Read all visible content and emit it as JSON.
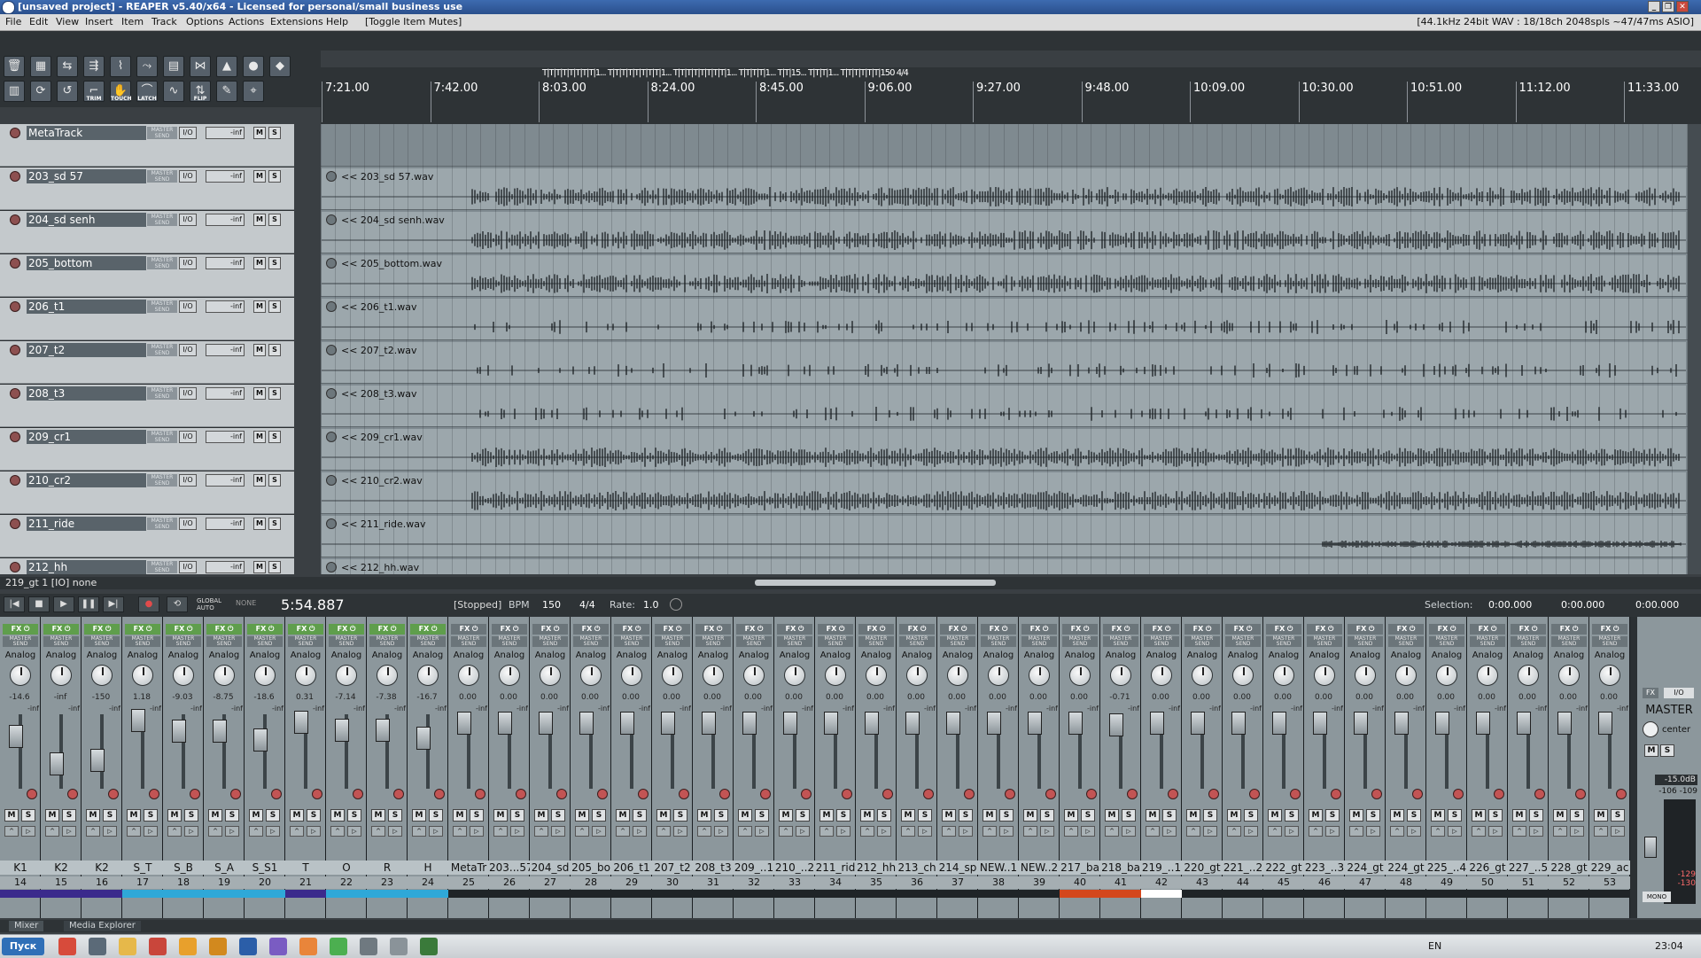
{
  "window": {
    "title": "[unsaved project] - REAPER v5.40/x64 - Licensed for personal/small business use",
    "controls": [
      "_",
      "❐",
      "✕"
    ]
  },
  "menu": {
    "items": [
      "File",
      "Edit",
      "View",
      "Insert",
      "Item",
      "Track",
      "Options",
      "Actions",
      "Extensions",
      "Help",
      "[Toggle Item Mutes]"
    ],
    "status": "[44.1kHz 24bit WAV : 18/18ch 2048spls ~47/47ms ASIO]"
  },
  "toolbar": {
    "row1": [
      {
        "icon": "trash-icon",
        "glyph": "🗑"
      },
      {
        "icon": "grid-icon",
        "glyph": "▦"
      },
      {
        "icon": "split-icon",
        "glyph": "⇆"
      },
      {
        "icon": "ripple-icon",
        "glyph": "⇶"
      },
      {
        "icon": "snap-icon",
        "glyph": "⌇"
      },
      {
        "icon": "envelope-icon",
        "glyph": "⤳"
      },
      {
        "icon": "group-icon",
        "glyph": "▤"
      },
      {
        "icon": "crossfade-icon",
        "glyph": "⋈"
      },
      {
        "icon": "metronome-icon",
        "glyph": "▲"
      },
      {
        "icon": "record-mode-icon",
        "glyph": "●"
      },
      {
        "icon": "render-icon",
        "glyph": "◆"
      }
    ],
    "row2": [
      {
        "icon": "mixer-icon",
        "glyph": "▥",
        "label": ""
      },
      {
        "icon": "loop-icon",
        "glyph": "⟳",
        "label": ""
      },
      {
        "icon": "undo-icon",
        "glyph": "↺",
        "label": ""
      },
      {
        "icon": "trim-icon",
        "glyph": "⌐",
        "label": "TRIM"
      },
      {
        "icon": "touch-icon",
        "glyph": "✋",
        "label": "TOUCH"
      },
      {
        "icon": "latch-icon",
        "glyph": "⌒",
        "label": "LATCH"
      },
      {
        "icon": "automation-icon",
        "glyph": "∿",
        "label": ""
      },
      {
        "icon": "flip-icon",
        "glyph": "⇅",
        "label": "FLIP"
      },
      {
        "icon": "pencil-icon",
        "glyph": "✎",
        "label": ""
      },
      {
        "icon": "cursor-icon",
        "glyph": "⌖",
        "label": ""
      }
    ]
  },
  "markers": {
    "text": "T|T|T|T|T|T|T|T|1... T|T|T|T|T|T|T|T|1... T|T|T|T|T|T|T|T|1... T|T|T|T|1... T|T|15... T|T|T|1... T|T|T|T|T|T|150 4/4"
  },
  "ruler": {
    "ticks": [
      "7:21.00",
      "7:42.00",
      "8:03.00",
      "8:24.00",
      "8:45.00",
      "9:06.00",
      "9:27.00",
      "9:48.00",
      "10:09.00",
      "10:30.00",
      "10:51.00",
      "11:12.00",
      "11:33.00"
    ]
  },
  "tracks": [
    {
      "name": "MetaTrack",
      "number": "25",
      "item": "",
      "vol": "-inf",
      "io": "I/O",
      "master_send": "MASTER SEND",
      "m": "M",
      "s": "S"
    },
    {
      "name": "203_sd 57",
      "number": "26",
      "item": "<< 203_sd 57.wav",
      "vol": "-inf",
      "io": "I/O",
      "master_send": "MASTER SEND",
      "m": "M",
      "s": "S"
    },
    {
      "name": "204_sd senh",
      "number": "27",
      "item": "<< 204_sd senh.wav",
      "vol": "-inf",
      "io": "I/O",
      "master_send": "MASTER SEND",
      "m": "M",
      "s": "S"
    },
    {
      "name": "205_bottom",
      "number": "28",
      "item": "<< 205_bottom.wav",
      "vol": "-inf",
      "io": "I/O",
      "master_send": "MASTER SEND",
      "m": "M",
      "s": "S"
    },
    {
      "name": "206_t1",
      "number": "29",
      "item": "<< 206_t1.wav",
      "vol": "-inf",
      "io": "I/O",
      "master_send": "MASTER SEND",
      "m": "M",
      "s": "S"
    },
    {
      "name": "207_t2",
      "number": "30",
      "item": "<< 207_t2.wav",
      "vol": "-inf",
      "io": "I/O",
      "master_send": "MASTER SEND",
      "m": "M",
      "s": "S"
    },
    {
      "name": "208_t3",
      "number": "31",
      "item": "<< 208_t3.wav",
      "vol": "-inf",
      "io": "I/O",
      "master_send": "MASTER SEND",
      "m": "M",
      "s": "S"
    },
    {
      "name": "209_cr1",
      "number": "32",
      "item": "<< 209_cr1.wav",
      "vol": "-inf",
      "io": "I/O",
      "master_send": "MASTER SEND",
      "m": "M",
      "s": "S"
    },
    {
      "name": "210_cr2",
      "number": "33",
      "item": "<< 210_cr2.wav",
      "vol": "-inf",
      "io": "I/O",
      "master_send": "MASTER SEND",
      "m": "M",
      "s": "S"
    },
    {
      "name": "211_ride",
      "number": "34",
      "item": "<< 211_ride.wav",
      "vol": "-inf",
      "io": "I/O",
      "master_send": "MASTER SEND",
      "m": "M",
      "s": "S"
    },
    {
      "name": "212_hh",
      "number": "35",
      "item": "<< 212_hh.wav",
      "vol": "-inf",
      "io": "I/O",
      "master_send": "MASTER SEND",
      "m": "M",
      "s": "S"
    }
  ],
  "status_line": "219_gt 1 [IO] none",
  "transport": {
    "buttons": [
      "|◀",
      "■",
      "▶",
      "❚❚",
      "▶|",
      "●",
      "⟲"
    ],
    "auto": "GLOBAL AUTO",
    "auto_state": "NONE",
    "time": "5:54.887",
    "state": "[Stopped]",
    "bpm_label": "BPM",
    "bpm": "150",
    "sig": "4/4",
    "rate_label": "Rate:",
    "rate": "1.0",
    "selection_label": "Selection:",
    "sel_start": "0:00.000",
    "sel_end": "0:00.000",
    "sel_len": "0:00.000"
  },
  "mixer": {
    "fx_label": "FX ⏻",
    "input_label": "Analog",
    "master_send": "MASTER SEND",
    "m": "M",
    "s": "S",
    "channels": [
      {
        "name": "K1",
        "num": "14",
        "db": "-14.6",
        "peak": "-inf",
        "fader": 0.62,
        "fx": true,
        "color": "#3b2a8c"
      },
      {
        "name": "K2",
        "num": "15",
        "db": "-inf",
        "peak": "-inf",
        "fader": 0.2,
        "fx": true,
        "color": "#3b2a8c"
      },
      {
        "name": "K2",
        "num": "16",
        "db": "-150",
        "peak": "-inf",
        "fader": 0.25,
        "fx": true,
        "color": "#3b2a8c"
      },
      {
        "name": "S_T",
        "num": "17",
        "db": "1.18",
        "peak": "-inf",
        "fader": 0.86,
        "fx": true,
        "color": "#2fa8d8"
      },
      {
        "name": "S_B",
        "num": "18",
        "db": "-9.03",
        "peak": "-inf",
        "fader": 0.7,
        "fx": true,
        "color": "#2fa8d8"
      },
      {
        "name": "S_A",
        "num": "19",
        "db": "-8.75",
        "peak": "-inf",
        "fader": 0.7,
        "fx": true,
        "color": "#2fa8d8"
      },
      {
        "name": "S_S1",
        "num": "20",
        "db": "-18.6",
        "peak": "-inf",
        "fader": 0.57,
        "fx": true,
        "color": "#2fa8d8"
      },
      {
        "name": "T",
        "num": "21",
        "db": "0.31",
        "peak": "-inf",
        "fader": 0.84,
        "fx": true,
        "color": "#3b2a8c"
      },
      {
        "name": "O",
        "num": "22",
        "db": "-7.14",
        "peak": "-inf",
        "fader": 0.72,
        "fx": true,
        "color": "#2fa8d8"
      },
      {
        "name": "R",
        "num": "23",
        "db": "-7.38",
        "peak": "-inf",
        "fader": 0.72,
        "fx": true,
        "color": "#2fa8d8"
      },
      {
        "name": "H",
        "num": "24",
        "db": "-16.7",
        "peak": "-inf",
        "fader": 0.6,
        "fx": true,
        "color": "#2fa8d8"
      },
      {
        "name": "MetaTr",
        "num": "25",
        "db": "0.00",
        "peak": "-inf",
        "fader": 0.82,
        "fx": false,
        "color": ""
      },
      {
        "name": "203...57",
        "num": "26",
        "db": "0.00",
        "peak": "-inf",
        "fader": 0.82,
        "fx": false,
        "color": ""
      },
      {
        "name": "204_sd",
        "num": "27",
        "db": "0.00",
        "peak": "-inf",
        "fader": 0.82,
        "fx": false,
        "color": ""
      },
      {
        "name": "205_bo",
        "num": "28",
        "db": "0.00",
        "peak": "-inf",
        "fader": 0.82,
        "fx": false,
        "color": ""
      },
      {
        "name": "206_t1",
        "num": "29",
        "db": "0.00",
        "peak": "-inf",
        "fader": 0.82,
        "fx": false,
        "color": ""
      },
      {
        "name": "207_t2",
        "num": "30",
        "db": "0.00",
        "peak": "-inf",
        "fader": 0.82,
        "fx": false,
        "color": ""
      },
      {
        "name": "208_t3",
        "num": "31",
        "db": "0.00",
        "peak": "-inf",
        "fader": 0.82,
        "fx": false,
        "color": ""
      },
      {
        "name": "209_..1",
        "num": "32",
        "db": "0.00",
        "peak": "-inf",
        "fader": 0.82,
        "fx": false,
        "color": ""
      },
      {
        "name": "210_..2",
        "num": "33",
        "db": "0.00",
        "peak": "-inf",
        "fader": 0.82,
        "fx": false,
        "color": ""
      },
      {
        "name": "211_rid",
        "num": "34",
        "db": "0.00",
        "peak": "-inf",
        "fader": 0.82,
        "fx": false,
        "color": ""
      },
      {
        "name": "212_hh",
        "num": "35",
        "db": "0.00",
        "peak": "-inf",
        "fader": 0.82,
        "fx": false,
        "color": ""
      },
      {
        "name": "213_ch",
        "num": "36",
        "db": "0.00",
        "peak": "-inf",
        "fader": 0.82,
        "fx": false,
        "color": ""
      },
      {
        "name": "214_sp",
        "num": "37",
        "db": "0.00",
        "peak": "-inf",
        "fader": 0.82,
        "fx": false,
        "color": ""
      },
      {
        "name": "NEW..1",
        "num": "38",
        "db": "0.00",
        "peak": "-inf",
        "fader": 0.82,
        "fx": false,
        "color": ""
      },
      {
        "name": "NEW..2",
        "num": "39",
        "db": "0.00",
        "peak": "-inf",
        "fader": 0.82,
        "fx": false,
        "color": ""
      },
      {
        "name": "217_ba",
        "num": "40",
        "db": "0.00",
        "peak": "-inf",
        "fader": 0.82,
        "fx": false,
        "color": "#d4471c"
      },
      {
        "name": "218_ba",
        "num": "41",
        "db": "-0.71",
        "peak": "-inf",
        "fader": 0.8,
        "fx": false,
        "color": "#d4471c"
      },
      {
        "name": "219_..1",
        "num": "42",
        "db": "0.00",
        "peak": "-inf",
        "fader": 0.82,
        "fx": false,
        "color": "#ffffff"
      },
      {
        "name": "220_gt",
        "num": "43",
        "db": "0.00",
        "peak": "-inf",
        "fader": 0.82,
        "fx": false,
        "color": ""
      },
      {
        "name": "221_..2",
        "num": "44",
        "db": "0.00",
        "peak": "-inf",
        "fader": 0.82,
        "fx": false,
        "color": ""
      },
      {
        "name": "222_gt",
        "num": "45",
        "db": "0.00",
        "peak": "-inf",
        "fader": 0.82,
        "fx": false,
        "color": ""
      },
      {
        "name": "223_..3",
        "num": "46",
        "db": "0.00",
        "peak": "-inf",
        "fader": 0.82,
        "fx": false,
        "color": ""
      },
      {
        "name": "224_gt",
        "num": "47",
        "db": "0.00",
        "peak": "-inf",
        "fader": 0.82,
        "fx": false,
        "color": ""
      },
      {
        "name": "224_gt",
        "num": "48",
        "db": "0.00",
        "peak": "-inf",
        "fader": 0.82,
        "fx": false,
        "color": ""
      },
      {
        "name": "225_..4",
        "num": "49",
        "db": "0.00",
        "peak": "-inf",
        "fader": 0.82,
        "fx": false,
        "color": ""
      },
      {
        "name": "226_gt",
        "num": "50",
        "db": "0.00",
        "peak": "-inf",
        "fader": 0.82,
        "fx": false,
        "color": ""
      },
      {
        "name": "227_..5",
        "num": "51",
        "db": "0.00",
        "peak": "-inf",
        "fader": 0.82,
        "fx": false,
        "color": ""
      },
      {
        "name": "228_gt",
        "num": "52",
        "db": "0.00",
        "peak": "-inf",
        "fader": 0.82,
        "fx": false,
        "color": ""
      },
      {
        "name": "229_ac",
        "num": "53",
        "db": "0.00",
        "peak": "-inf",
        "fader": 0.82,
        "fx": false,
        "color": ""
      }
    ],
    "master": {
      "fx": "FX",
      "io": "I/O",
      "name": "MASTER",
      "pan": "center",
      "m": "M",
      "s": "S",
      "db": "-15.0dB",
      "peak": "-106 -109",
      "peak2": "-129 -130",
      "mono": "MONO",
      "fader": 0.55
    }
  },
  "tabs": [
    "Mixer",
    "Media Explorer"
  ],
  "taskbar": {
    "start": "Пуск",
    "lang": "EN",
    "clock": "23:04"
  },
  "colors": {
    "track_panel": "#c4c9cc",
    "item_bg": "#9ca7ac",
    "waveform": "#1a1f22",
    "arrange_bg": "#7f8a90",
    "fx_on": "#5f9e4c"
  }
}
